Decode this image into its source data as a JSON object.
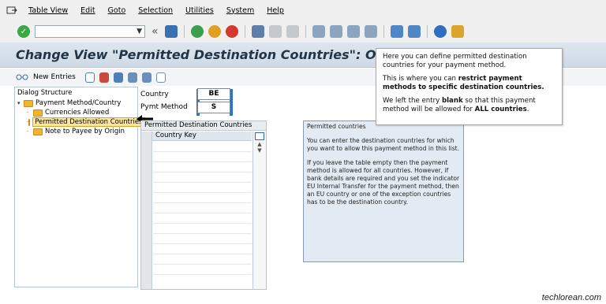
{
  "menubar": {
    "items": [
      "Table View",
      "Edit",
      "Goto",
      "Selection",
      "Utilities",
      "System",
      "Help"
    ]
  },
  "toolbar": {
    "command_value": "",
    "icons": [
      "enter-icon",
      "save-icon",
      "back-icon",
      "exit-icon",
      "cancel-icon",
      "print-icon",
      "find-icon",
      "find-next-icon",
      "first-page-icon",
      "previous-page-icon",
      "next-page-icon",
      "last-page-icon",
      "new-session-icon",
      "shortcut-icon",
      "help-icon",
      "customize-layout-icon"
    ]
  },
  "title": "Change View \"Permitted Destination Countries\": Overview",
  "app_toolbar": {
    "new_entries": "New Entries"
  },
  "dialog_structure": {
    "header": "Dialog Structure",
    "items": [
      {
        "label": "Payment Method/Country",
        "level": 0
      },
      {
        "label": "Currencies Allowed",
        "level": 1
      },
      {
        "label": "Permitted Destination Countries",
        "level": 1,
        "selected": true
      },
      {
        "label": "Note to Payee by Origin",
        "level": 1
      }
    ]
  },
  "fields": {
    "country_label": "Country",
    "country_value": "BE",
    "pymt_label": "Pymt Method",
    "pymt_value": "S"
  },
  "table": {
    "title": "Permitted Destination Countries",
    "column": "Country Key"
  },
  "help": {
    "title": "Permitted countries",
    "p1": "You can enter the destination countries for which you want to allow this payment method in this list.",
    "p2": "If you leave the table empty then the payment method is allowed for all countries. However, if bank details are required and you set the indicator EU Internal Transfer for the payment method, then an EU country or one of the exception countries has to be the destination country."
  },
  "callout": {
    "p1": "Here you can define permitted destination countries for your payment method.",
    "p2_a": "This is where you can ",
    "p2_b": "restrict payment methods to specific destination countries.",
    "p3_a": "We left the entry ",
    "p3_b": "blank",
    "p3_c": " so that this payment method will be allowed for ",
    "p3_d": "ALL countries",
    "p3_e": "."
  },
  "watermark": "techlorean.com"
}
